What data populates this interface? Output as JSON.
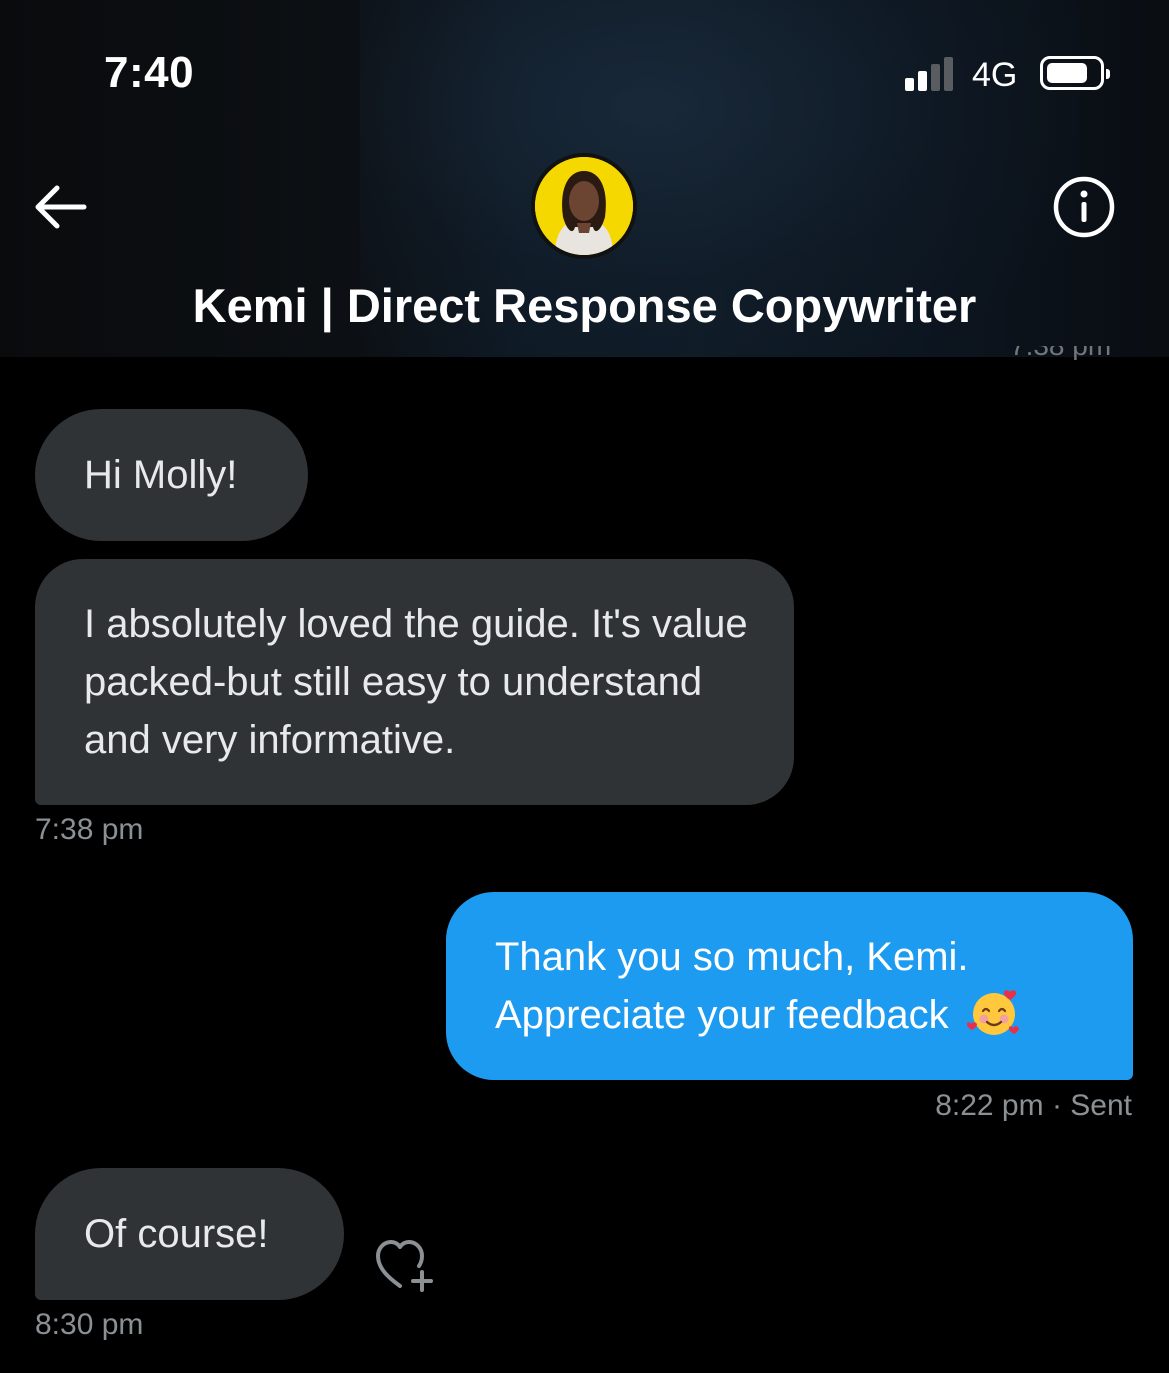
{
  "status_bar": {
    "time": "7:40",
    "network": "4G",
    "signal_bars_active": 2,
    "signal_bars_total": 4
  },
  "header": {
    "contact_name": "Kemi | Direct Response Copywriter",
    "back_icon": "arrow-left-icon",
    "info_icon": "info-circle-icon",
    "avatar_border_color": "#f5d800"
  },
  "conversation": {
    "clipped_timestamp": "7:38 pm",
    "messages": [
      {
        "from": "them",
        "text": "Hi Molly!"
      },
      {
        "from": "them",
        "text": "I absolutely loved the guide. It's value packed-but still easy to understand and very informative.",
        "time": "7:38 pm"
      },
      {
        "from": "me",
        "text": "Thank you so much, Kemi. Appreciate your feedback",
        "emoji": "smiling-face-with-hearts",
        "time": "8:22 pm",
        "status": "Sent"
      },
      {
        "from": "them",
        "text": "Of course!",
        "time": "8:30 pm"
      }
    ],
    "react_icon": "heart-plus-icon"
  },
  "colors": {
    "incoming_bubble": "#2f3336",
    "outgoing_bubble": "#1d9bf0",
    "timestamp": "#8b9095"
  }
}
